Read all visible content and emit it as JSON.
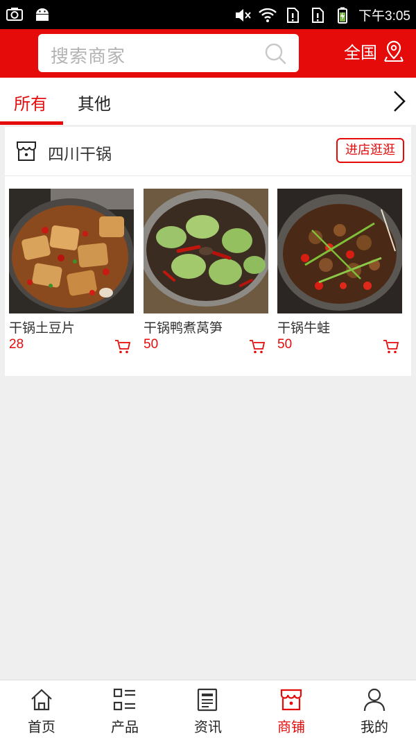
{
  "status_bar": {
    "time": "下午3:05"
  },
  "header": {
    "search": {
      "placeholder": "搜索商家"
    },
    "region_label": "全国"
  },
  "tabs": [
    {
      "label": "所有",
      "active": true
    },
    {
      "label": "其他",
      "active": false
    }
  ],
  "shop": {
    "name": "四川干锅",
    "visit_label": "进店逛逛",
    "products": [
      {
        "name": "干锅土豆片",
        "price": "28"
      },
      {
        "name": "干锅鸭煮莴笋",
        "price": "50"
      },
      {
        "name": "干锅牛蛙",
        "price": "50"
      }
    ]
  },
  "bottom_nav": [
    {
      "label": "首页",
      "icon": "home-icon",
      "active": false
    },
    {
      "label": "产品",
      "icon": "grid-list-icon",
      "active": false
    },
    {
      "label": "资讯",
      "icon": "news-icon",
      "active": false
    },
    {
      "label": "商铺",
      "icon": "store-icon",
      "active": true
    },
    {
      "label": "我的",
      "icon": "user-icon",
      "active": false
    }
  ],
  "colors": {
    "accent": "#e50b0b",
    "background": "#efefef"
  }
}
